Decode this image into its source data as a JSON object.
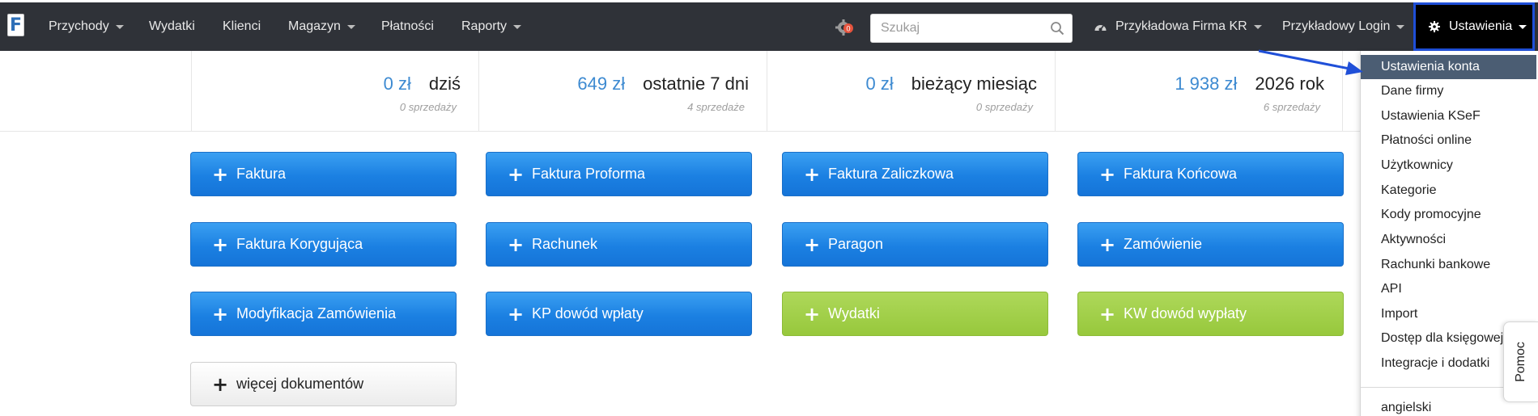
{
  "nav": {
    "brand_letter": "F",
    "items": [
      {
        "label": "Przychody",
        "caret": true
      },
      {
        "label": "Wydatki",
        "caret": false
      },
      {
        "label": "Klienci",
        "caret": false
      },
      {
        "label": "Magazyn",
        "caret": true
      },
      {
        "label": "Płatności",
        "caret": false
      },
      {
        "label": "Raporty",
        "caret": true
      }
    ],
    "notification_count": "0",
    "search_placeholder": "Szukaj",
    "company": "Przykładowa Firma KR",
    "login": "Przykładowy Login",
    "settings": "Ustawienia"
  },
  "stats": [
    {
      "amount": "0 zł",
      "period": "dziś",
      "sales": "0 sprzedaży"
    },
    {
      "amount": "649 zł",
      "period": "ostatnie 7 dni",
      "sales": "4 sprzedaże"
    },
    {
      "amount": "0 zł",
      "period": "bieżący miesiąc",
      "sales": "0 sprzedaży"
    },
    {
      "amount": "1 938 zł",
      "period": "2026 rok",
      "sales": "6 sprzedaży"
    }
  ],
  "documents": [
    {
      "label": "Faktura",
      "style": "blue"
    },
    {
      "label": "Faktura Proforma",
      "style": "blue"
    },
    {
      "label": "Faktura Zaliczkowa",
      "style": "blue"
    },
    {
      "label": "Faktura Końcowa",
      "style": "blue"
    },
    {
      "label": "Faktura Korygująca",
      "style": "blue"
    },
    {
      "label": "Rachunek",
      "style": "blue"
    },
    {
      "label": "Paragon",
      "style": "blue"
    },
    {
      "label": "Zamówienie",
      "style": "blue"
    },
    {
      "label": "Modyfikacja Zamówienia",
      "style": "blue"
    },
    {
      "label": "KP dowód wpłaty",
      "style": "blue"
    },
    {
      "label": "Wydatki",
      "style": "green"
    },
    {
      "label": "KW dowód wypłaty",
      "style": "green"
    },
    {
      "label": "więcej dokumentów",
      "style": "light"
    }
  ],
  "settings_menu": {
    "items": [
      "Ustawienia konta",
      "Dane firmy",
      "Ustawienia KSeF",
      "Płatności online",
      "Użytkownicy",
      "Kategorie",
      "Kody promocyjne",
      "Aktywności",
      "Rachunki bankowe",
      "API",
      "Import",
      "Dostęp dla księgowej",
      "Integracje i dodatki"
    ],
    "active_index": 0,
    "language": "angielski"
  },
  "help_tab": "Pomoc",
  "colors": {
    "navbar": "#2f3238",
    "accent_blue": "#1b80e2",
    "accent_green": "#97c83c",
    "amount_blue": "#3d8ad1",
    "menu_active": "#4b5d73",
    "highlight_border": "#1f4fd8"
  }
}
